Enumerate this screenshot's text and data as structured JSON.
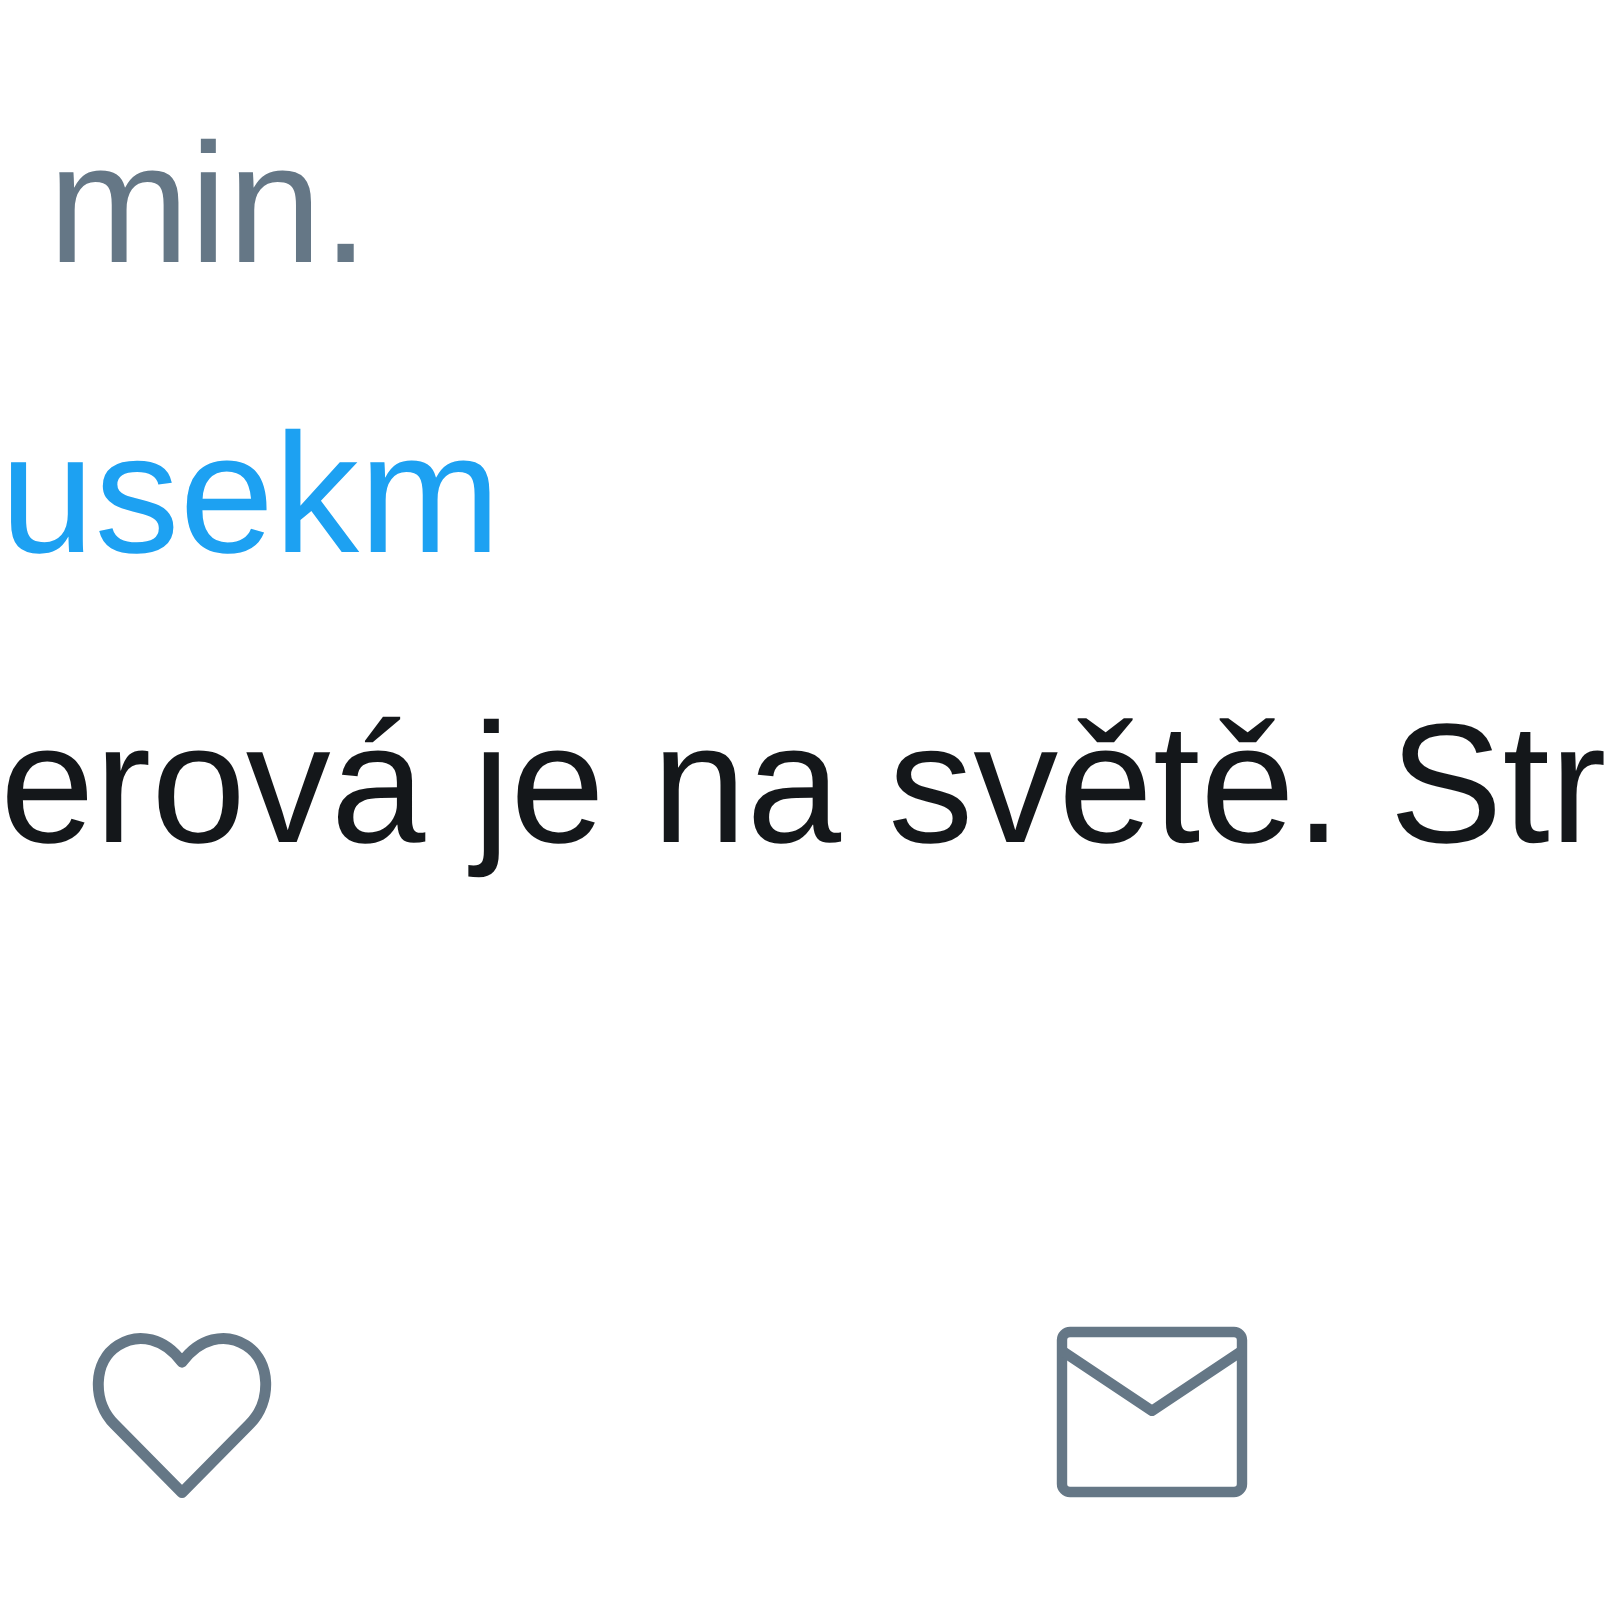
{
  "tweet": {
    "time": "min.",
    "handle": "usekm",
    "text": "erová je na světě. Str",
    "liked": false
  }
}
